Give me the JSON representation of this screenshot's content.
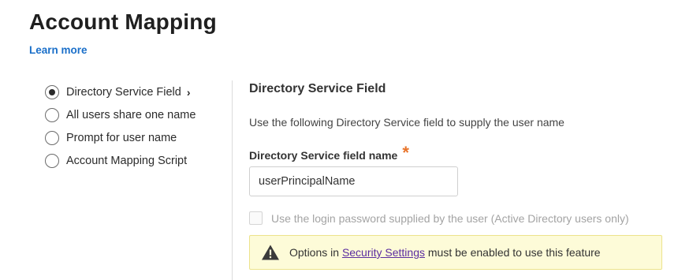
{
  "page": {
    "title": "Account Mapping",
    "learn_more": "Learn more"
  },
  "options": [
    {
      "label": "Directory Service Field",
      "selected": true,
      "chevron": "›"
    },
    {
      "label": "All users share one name",
      "selected": false
    },
    {
      "label": "Prompt for user name",
      "selected": false
    },
    {
      "label": "Account Mapping Script",
      "selected": false
    }
  ],
  "panel": {
    "title": "Directory Service Field",
    "description": "Use the following Directory Service field to supply the user name",
    "field_label": "Directory Service field name",
    "required_mark": "*",
    "field_value": "userPrincipalName",
    "checkbox_label": "Use the login password supplied by the user (Active Directory users only)",
    "checkbox_checked": false,
    "warning": {
      "prefix": "Options in",
      "link": "Security Settings",
      "suffix": "must be enabled to use this feature",
      "icon": "warning-triangle-icon"
    }
  },
  "colors": {
    "link": "#1a6fc9",
    "required": "#e8742a",
    "warning_bg": "#fdfbd8",
    "warning_link": "#5b2ca0"
  }
}
